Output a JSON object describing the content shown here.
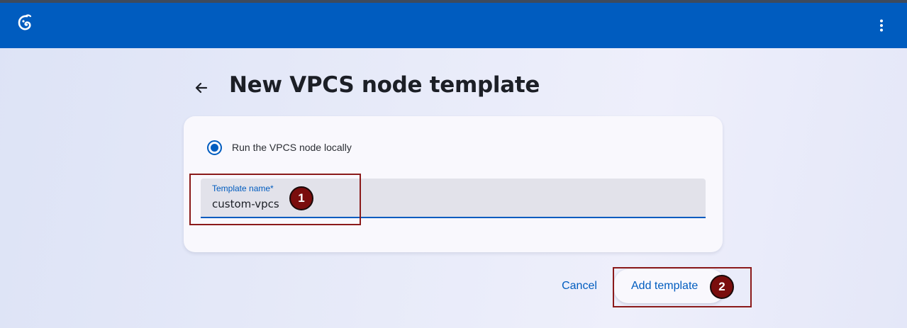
{
  "appbar": {
    "logo_icon": "gns3-logo-icon",
    "menu_icon": "more-vertical-icon",
    "color": "#005cbf"
  },
  "header": {
    "back_icon": "arrow-left-icon",
    "title": "New VPCS node template"
  },
  "form": {
    "radio_label": "Run the VPCS node locally",
    "radio_selected": true,
    "template_name": {
      "label": "Template name*",
      "value": "custom-vpcs"
    }
  },
  "actions": {
    "cancel_label": "Cancel",
    "add_label": "Add template"
  },
  "annotations": [
    {
      "number": "1"
    },
    {
      "number": "2"
    }
  ],
  "colors": {
    "accent": "#005cbf",
    "annotation": "#7a0d0d",
    "card": "#f9f8fd"
  }
}
